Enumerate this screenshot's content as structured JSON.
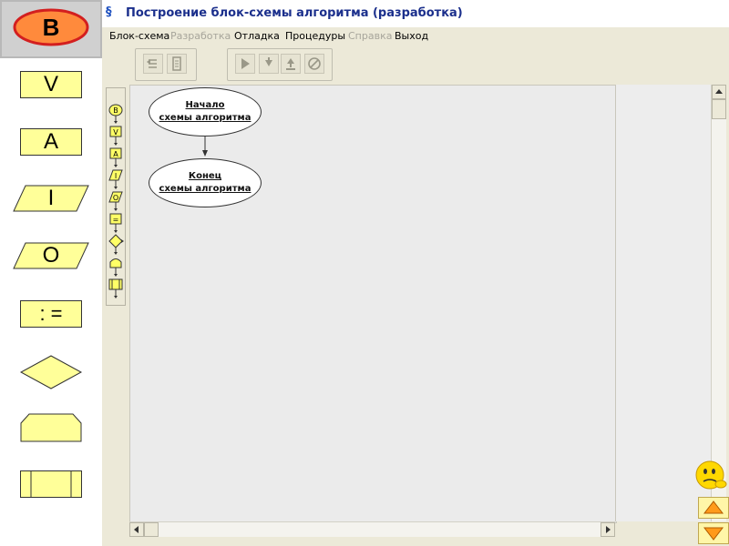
{
  "legend": {
    "items": [
      {
        "id": "begin",
        "label": "В"
      },
      {
        "id": "input",
        "label": "V"
      },
      {
        "id": "output",
        "label": "A"
      },
      {
        "id": "read",
        "label": "I"
      },
      {
        "id": "write",
        "label": "O"
      },
      {
        "id": "assign",
        "label": ": ="
      },
      {
        "id": "condition",
        "label": ""
      },
      {
        "id": "loop",
        "label": ""
      },
      {
        "id": "procedure",
        "label": ""
      }
    ]
  },
  "window": {
    "title": "Построение блок-схемы алгоритма (разработка)"
  },
  "menu": {
    "items": [
      {
        "label": "Блок-схема",
        "enabled": true
      },
      {
        "label": "Разработка",
        "enabled": false
      },
      {
        "label": "Отладка",
        "enabled": true
      },
      {
        "label": "Процедуры",
        "enabled": true
      },
      {
        "label": "Справка",
        "enabled": false
      },
      {
        "label": "Выход",
        "enabled": true
      }
    ]
  },
  "palette": {
    "items": [
      {
        "id": "begin",
        "label": "В"
      },
      {
        "id": "input",
        "label": "V"
      },
      {
        "id": "output",
        "label": "A"
      },
      {
        "id": "read",
        "label": "I"
      },
      {
        "id": "write",
        "label": "O"
      },
      {
        "id": "assign",
        "label": "="
      },
      {
        "id": "condition",
        "label": ""
      },
      {
        "id": "loop",
        "label": ""
      },
      {
        "id": "procedure",
        "label": ""
      }
    ]
  },
  "flowchart": {
    "start": {
      "line1": "Начало",
      "line2": "схемы алгоритма"
    },
    "end": {
      "line1": "Конец",
      "line2": "схемы алгоритма"
    }
  },
  "colors": {
    "shape_fill": "#ffff99",
    "selected_shape_fill": "#ff8a3c",
    "selected_shape_border": "#d31f1f",
    "title_text": "#1b2f8c",
    "disabled_menu": "#a7a59b"
  },
  "icons": {
    "toolbar": [
      "step-back-icon",
      "build-icon",
      "run-icon",
      "step-into-icon",
      "step-over-icon",
      "stop-icon"
    ],
    "mascot": "thinking-smiley-icon",
    "nav": [
      "arrow-up-icon",
      "arrow-down-icon"
    ]
  }
}
